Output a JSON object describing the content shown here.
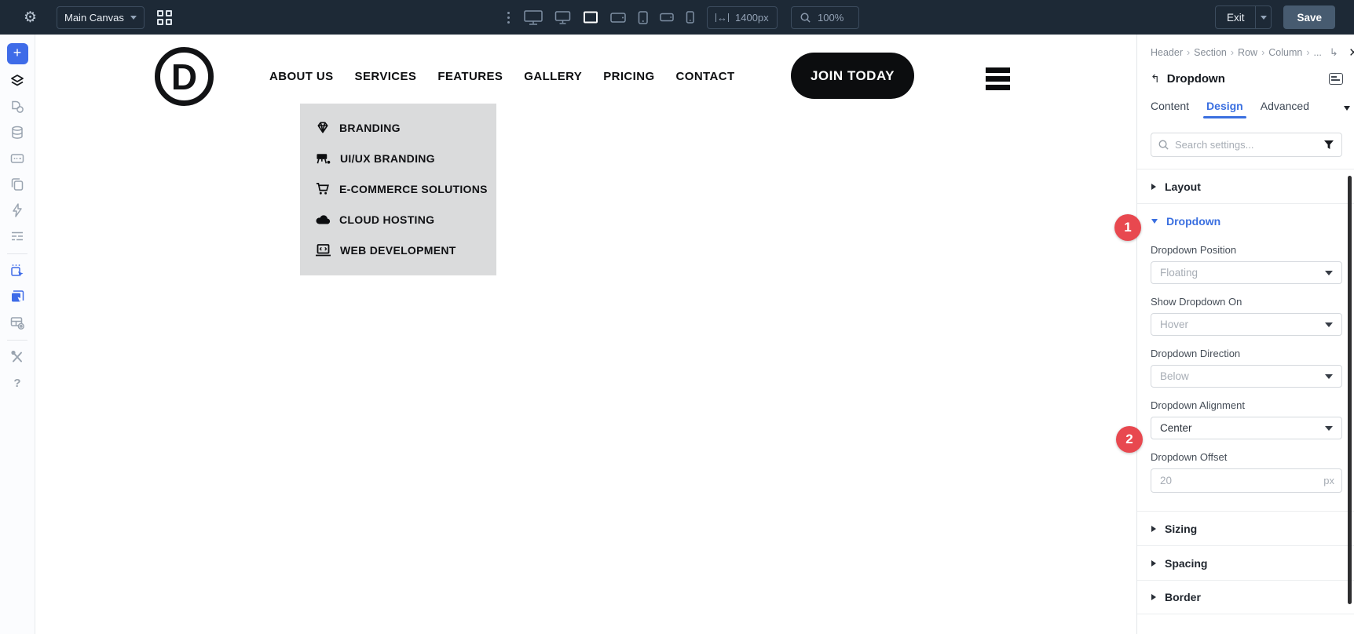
{
  "toolbar": {
    "canvas_selector": "Main Canvas",
    "width_value": "1400px",
    "zoom_value": "100%",
    "exit_label": "Exit",
    "save_label": "Save",
    "device_icons": [
      "desktop-large-icon",
      "desktop-icon",
      "laptop-icon-active",
      "tablet-landscape-icon",
      "tablet-portrait-icon",
      "phone-landscape-icon",
      "phone-portrait-icon"
    ]
  },
  "sidebar": {
    "icons": [
      "add",
      "layers",
      "design-library",
      "database",
      "form-field",
      "templates",
      "actions",
      "structure",
      "select-mode",
      "multi-select-mode",
      "grid-settings",
      "tools",
      "help"
    ],
    "help_glyph": "?"
  },
  "canvas": {
    "logo_letter": "D",
    "nav_items": [
      "ABOUT US",
      "SERVICES",
      "FEATURES",
      "GALLERY",
      "PRICING",
      "CONTACT"
    ],
    "cta_label": "JOIN TODAY",
    "dropdown_menu": {
      "items": [
        {
          "icon": "gem-icon",
          "label": "BRANDING"
        },
        {
          "icon": "design-icon",
          "label": "UI/UX BRANDING"
        },
        {
          "icon": "cart-icon",
          "label": "E-COMMERCE SOLUTIONS"
        },
        {
          "icon": "cloud-icon",
          "label": "CLOUD HOSTING"
        },
        {
          "icon": "laptop-code-icon",
          "label": "WEB DEVELOPMENT"
        }
      ]
    }
  },
  "panel": {
    "breadcrumb": {
      "items": [
        "Header",
        "Section",
        "Row",
        "Column"
      ],
      "separator": "›",
      "overflow": "...",
      "up_glyph": "↳",
      "close_glyph": "×"
    },
    "back_glyph": "↰",
    "element_title": "Dropdown",
    "tabs": [
      "Content",
      "Design",
      "Advanced"
    ],
    "active_tab": "Design",
    "search_placeholder": "Search settings...",
    "sections": [
      {
        "label": "Layout",
        "state": "collapsed"
      },
      {
        "label": "Dropdown",
        "state": "expanded"
      },
      {
        "label": "Sizing",
        "state": "collapsed"
      },
      {
        "label": "Spacing",
        "state": "collapsed"
      },
      {
        "label": "Border",
        "state": "collapsed"
      }
    ],
    "dropdown_settings": [
      {
        "label": "Dropdown Position",
        "value": "Floating",
        "control": "select",
        "value_state": "placeholder"
      },
      {
        "label": "Show Dropdown On",
        "value": "Hover",
        "control": "select",
        "value_state": "placeholder"
      },
      {
        "label": "Dropdown Direction",
        "value": "Below",
        "control": "select",
        "value_state": "placeholder"
      },
      {
        "label": "Dropdown Alignment",
        "value": "Center",
        "control": "select",
        "value_state": "set"
      },
      {
        "label": "Dropdown Offset",
        "value": "20",
        "suffix": "px",
        "control": "input"
      }
    ]
  },
  "annotations": {
    "badges": [
      "1",
      "2"
    ],
    "color": "#e8484f"
  },
  "colors": {
    "toolbar_bg": "#1d2936",
    "accent_blue": "#3a6fe0",
    "sidebar_accent": "#3e6be8",
    "badge_red": "#e8484f",
    "save_bg": "#475b70",
    "canvas_menu_bg": "#dadbdc",
    "cta_bg": "#0c0d0f"
  }
}
